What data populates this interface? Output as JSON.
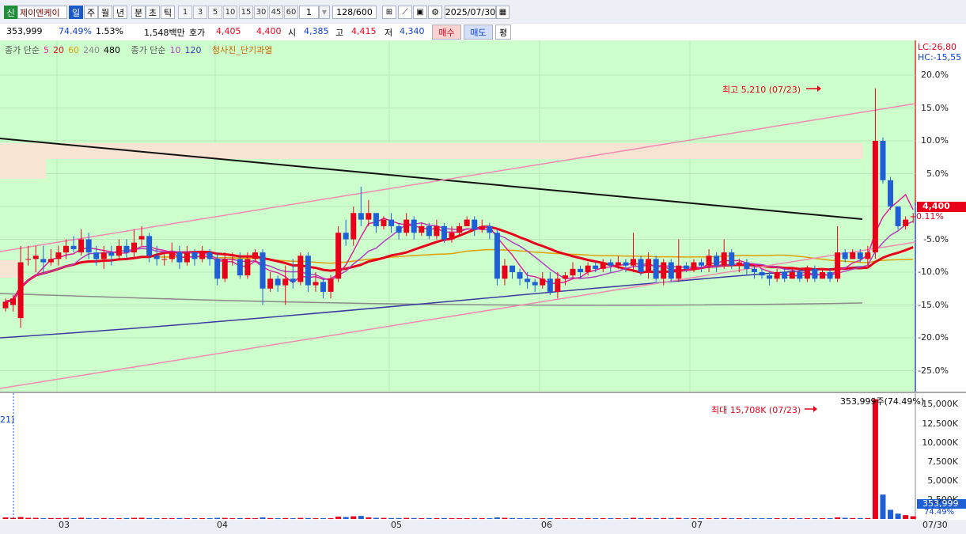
{
  "toolbar": {
    "credit_flag": "신",
    "stock_name": "제이엔케이",
    "periods": [
      {
        "label": "일",
        "selected": true
      },
      {
        "label": "주",
        "selected": false
      },
      {
        "label": "월",
        "selected": false
      },
      {
        "label": "년",
        "selected": false
      },
      {
        "label": "분",
        "selected": false
      },
      {
        "label": "초",
        "selected": false
      },
      {
        "label": "틱",
        "selected": false
      }
    ],
    "intervals": [
      "1",
      "3",
      "5",
      "10",
      "15",
      "30",
      "45",
      "60"
    ],
    "interval_value": "1",
    "count": "128/600",
    "date": "2025/07/30"
  },
  "quote": {
    "volume": "353,999",
    "volume_ratio": "74.49%",
    "change_rate": "1.53%",
    "amount": "1,548백만",
    "bid_label": "호가",
    "ask": "4,405",
    "bid": "4,400",
    "open_label": "시",
    "open": "4,385",
    "high_label": "고",
    "high": "4,415",
    "low_label": "저",
    "low": "4,340",
    "buy_button": "매수",
    "sell_button": "매도",
    "eval_button": "평"
  },
  "legend": {
    "ma_label": "종가 단순",
    "ma_periods": [
      "5",
      "20",
      "60",
      "240",
      "480"
    ],
    "ma_colors": [
      "#e0209a",
      "#e8001a",
      "#e0a000",
      "#8a8a8a",
      "#000000"
    ],
    "ma2_label": "종가 단순",
    "ma2_periods": [
      "10",
      "120"
    ],
    "ma2_colors": [
      "#b040c0",
      "#3a3aa0"
    ],
    "signal": "청사진_단기과열"
  },
  "price_axis": {
    "lc": "LC:26,80",
    "hc": "HC:-15,55",
    "ticks": [
      "20.0%",
      "15.0%",
      "10.0%",
      "5.0%",
      "0.11%",
      "-5.0%",
      "-10.0%",
      "-15.0%",
      "-20.0%",
      "-25.0%"
    ],
    "current_price": "4,400",
    "current_pct": "0.11%"
  },
  "annotations": {
    "high": "최고 5,210 (07/23)",
    "max_volume": "최대 15,708K (07/23)",
    "volume_summary": "353,999주(74.49%)",
    "left_marker": "21)"
  },
  "volume_axis": {
    "ticks": [
      "15,000K",
      "12,500K",
      "10,000K",
      "7,500K",
      "5,000K",
      "2,500K"
    ],
    "current_volume": "353,999",
    "current_pct": "74.49%"
  },
  "x_axis": {
    "labels": [
      "03",
      "04",
      "05",
      "06",
      "07"
    ],
    "end_label": "07/30"
  },
  "chart_data": {
    "type": "candlestick",
    "scale": "percent change vs reference",
    "y_range": [
      -28,
      24
    ],
    "candles": [
      [
        -15.5,
        -14.5,
        -14,
        -16
      ],
      [
        -15,
        -14,
        -13.5,
        -16
      ],
      [
        -17,
        -8.5,
        -6,
        -18.5
      ],
      [
        -8,
        -8,
        -6,
        -9
      ],
      [
        -8,
        -7.5,
        -6,
        -10
      ],
      [
        -8,
        -8.5,
        -6,
        -10
      ],
      [
        -8.5,
        -8,
        -6.5,
        -9
      ],
      [
        -8,
        -7,
        -6,
        -9
      ],
      [
        -7,
        -6,
        -5,
        -8
      ],
      [
        -6,
        -6.5,
        -4.5,
        -7
      ],
      [
        -7,
        -5,
        -3.5,
        -7.5
      ],
      [
        -5,
        -7,
        -4,
        -8
      ],
      [
        -7,
        -8,
        -6,
        -9
      ],
      [
        -8,
        -7,
        -6,
        -9.5
      ],
      [
        -7,
        -7.5,
        -6,
        -9
      ],
      [
        -7.5,
        -6,
        -5,
        -8
      ],
      [
        -6,
        -7,
        -5,
        -8
      ],
      [
        -7,
        -5.5,
        -3.5,
        -8
      ],
      [
        -5,
        -4.5,
        -3,
        -6
      ],
      [
        -4.5,
        -7.5,
        -4,
        -8.5
      ],
      [
        -7.5,
        -8,
        -6,
        -9
      ],
      [
        -8,
        -8,
        -7,
        -9
      ],
      [
        -8,
        -7,
        -5.5,
        -8.5
      ],
      [
        -7,
        -8.5,
        -6,
        -9.5
      ],
      [
        -8.5,
        -7,
        -6,
        -9
      ],
      [
        -7,
        -8,
        -6.5,
        -9
      ],
      [
        -8,
        -7,
        -6,
        -8.5
      ],
      [
        -7,
        -8,
        -6.5,
        -9
      ],
      [
        -8,
        -11,
        -7,
        -12
      ],
      [
        -11,
        -8,
        -7,
        -11.5
      ],
      [
        -8,
        -8,
        -7,
        -9
      ],
      [
        -8,
        -10.5,
        -7,
        -11
      ],
      [
        -10.5,
        -8,
        -7,
        -11
      ],
      [
        -8,
        -7,
        -6.5,
        -8.5
      ],
      [
        -7,
        -12.5,
        -6.5,
        -15
      ],
      [
        -12.5,
        -11,
        -10,
        -13
      ],
      [
        -11,
        -12,
        -10.5,
        -13
      ],
      [
        -12,
        -11,
        -9,
        -15
      ],
      [
        -11,
        -11.5,
        -8,
        -12.5
      ],
      [
        -11.5,
        -7.5,
        -7,
        -12
      ],
      [
        -7.5,
        -12,
        -7,
        -13
      ],
      [
        -12,
        -11.5,
        -10,
        -13
      ],
      [
        -11.5,
        -13,
        -11,
        -14
      ],
      [
        -13,
        -11,
        -10.5,
        -14
      ],
      [
        -11,
        -4,
        -3,
        -11.5
      ],
      [
        -4,
        -5,
        -2,
        -6
      ],
      [
        -5,
        -1,
        0,
        -6
      ],
      [
        -1,
        -2,
        3,
        -3
      ],
      [
        -2,
        -1,
        1,
        -3
      ],
      [
        -1,
        -3,
        -1,
        -4
      ],
      [
        -3,
        -2,
        -1.5,
        -3.5
      ],
      [
        -2,
        -3,
        -1,
        -4
      ],
      [
        -3,
        -4,
        -2.5,
        -5
      ],
      [
        -4,
        -2,
        -1,
        -4.5
      ],
      [
        -2,
        -4,
        -1.5,
        -5
      ],
      [
        -4,
        -3,
        -2.5,
        -4.5
      ],
      [
        -3,
        -4.5,
        -2.5,
        -5
      ],
      [
        -4.5,
        -3,
        -2,
        -5
      ],
      [
        -3,
        -5,
        -2.5,
        -5.5
      ],
      [
        -5,
        -4,
        -3,
        -5.5
      ],
      [
        -4,
        -3,
        -2.5,
        -4.5
      ],
      [
        -3,
        -2,
        -1.5,
        -3
      ],
      [
        -2,
        -3.5,
        -1.5,
        -4.5
      ],
      [
        -3.5,
        -3,
        -2,
        -4
      ],
      [
        -3,
        -4,
        -2.5,
        -5
      ],
      [
        -4,
        -11,
        -3.5,
        -12
      ],
      [
        -11,
        -9,
        -8,
        -12
      ],
      [
        -9,
        -10,
        -9,
        -11
      ],
      [
        -10,
        -11,
        -9.5,
        -12
      ],
      [
        -11,
        -11.5,
        -10,
        -12.5
      ],
      [
        -11.5,
        -12,
        -11,
        -13
      ],
      [
        -12,
        -11,
        -10,
        -12.5
      ],
      [
        -11,
        -13,
        -10,
        -13.5
      ],
      [
        -13,
        -11,
        -10,
        -14
      ],
      [
        -11,
        -10.5,
        -10,
        -12
      ],
      [
        -10.5,
        -9.5,
        -8.5,
        -11
      ],
      [
        -9.5,
        -10,
        -9,
        -11
      ],
      [
        -10,
        -9,
        -8.5,
        -10.5
      ],
      [
        -9,
        -9.5,
        -8.5,
        -10
      ],
      [
        -9.5,
        -8.5,
        -8,
        -10
      ],
      [
        -8.5,
        -9,
        -8,
        -10
      ],
      [
        -9,
        -8.5,
        -7.5,
        -9.5
      ],
      [
        -8.5,
        -9,
        -8,
        -10
      ],
      [
        -9,
        -8,
        -4,
        -10
      ],
      [
        -8,
        -10,
        -7.5,
        -10.5
      ],
      [
        -10,
        -8,
        -7,
        -11
      ],
      [
        -8,
        -11,
        -7.5,
        -11.5
      ],
      [
        -11,
        -8.5,
        -8,
        -12
      ],
      [
        -8.5,
        -11,
        -8,
        -11.5
      ],
      [
        -11,
        -9,
        -5,
        -11.5
      ],
      [
        -9,
        -9.5,
        -8.5,
        -10
      ],
      [
        -9.5,
        -8.5,
        -8,
        -10
      ],
      [
        -8.5,
        -9,
        -8,
        -10
      ],
      [
        -9,
        -7.5,
        -6.5,
        -10
      ],
      [
        -7.5,
        -9,
        -7,
        -10
      ],
      [
        -9,
        -7,
        -5,
        -9.5
      ],
      [
        -7,
        -9,
        -6.5,
        -9.5
      ],
      [
        -9,
        -8.5,
        -8,
        -10
      ],
      [
        -8.5,
        -9.5,
        -8,
        -10.5
      ],
      [
        -9.5,
        -10,
        -9,
        -11
      ],
      [
        -10,
        -10.5,
        -9.5,
        -11
      ],
      [
        -10.5,
        -11,
        -10,
        -12
      ],
      [
        -11,
        -10,
        -9.5,
        -11.5
      ],
      [
        -10,
        -11,
        -9.5,
        -11.5
      ],
      [
        -11,
        -10,
        -9.5,
        -11
      ],
      [
        -10,
        -11,
        -9.5,
        -11.5
      ],
      [
        -11,
        -9.5,
        -9,
        -11.5
      ],
      [
        -9.5,
        -11,
        -9,
        -11.5
      ],
      [
        -11,
        -10,
        -9.5,
        -11
      ],
      [
        -10,
        -11,
        -9.5,
        -11.5
      ],
      [
        -11,
        -7,
        -3,
        -11.5
      ],
      [
        -7,
        -8,
        -6.5,
        -8.5
      ],
      [
        -8,
        -7,
        -6.5,
        -8
      ],
      [
        -7,
        -8,
        -6.5,
        -8.5
      ],
      [
        -8,
        -7,
        -6,
        -9
      ],
      [
        -7,
        10,
        18,
        -8
      ],
      [
        10,
        4,
        10.5,
        3.5
      ],
      [
        4,
        0,
        4.5,
        -0.5
      ],
      [
        0,
        -3,
        0,
        -3.5
      ],
      [
        -3,
        -2,
        -1.5,
        -3.5
      ],
      [
        -1.5,
        -1.5,
        -1,
        -2.5
      ]
    ],
    "volumes": [
      0.2,
      0.15,
      0.25,
      0.15,
      0.15,
      0.1,
      0.12,
      0.12,
      0.14,
      0.1,
      0.16,
      0.12,
      0.1,
      0.12,
      0.1,
      0.1,
      0.12,
      0.15,
      0.16,
      0.12,
      0.1,
      0.1,
      0.1,
      0.12,
      0.1,
      0.1,
      0.1,
      0.1,
      0.15,
      0.14,
      0.1,
      0.12,
      0.12,
      0.1,
      0.2,
      0.12,
      0.1,
      0.12,
      0.1,
      0.14,
      0.12,
      0.1,
      0.1,
      0.1,
      0.3,
      0.25,
      0.35,
      0.4,
      0.2,
      0.15,
      0.14,
      0.12,
      0.12,
      0.14,
      0.12,
      0.1,
      0.12,
      0.1,
      0.12,
      0.1,
      0.1,
      0.1,
      0.12,
      0.1,
      0.1,
      0.2,
      0.15,
      0.12,
      0.1,
      0.1,
      0.1,
      0.1,
      0.12,
      0.1,
      0.1,
      0.1,
      0.1,
      0.1,
      0.1,
      0.1,
      0.1,
      0.1,
      0.1,
      0.15,
      0.12,
      0.12,
      0.12,
      0.12,
      0.12,
      0.14,
      0.1,
      0.1,
      0.1,
      0.1,
      0.1,
      0.12,
      0.1,
      0.1,
      0.1,
      0.1,
      0.1,
      0.1,
      0.1,
      0.1,
      0.1,
      0.1,
      0.1,
      0.1,
      0.1,
      0.1,
      0.2,
      0.15,
      0.12,
      0.12,
      0.12,
      15.708,
      3.2,
      1.2,
      0.7,
      0.5,
      0.354
    ],
    "volume_max": 16.5
  }
}
